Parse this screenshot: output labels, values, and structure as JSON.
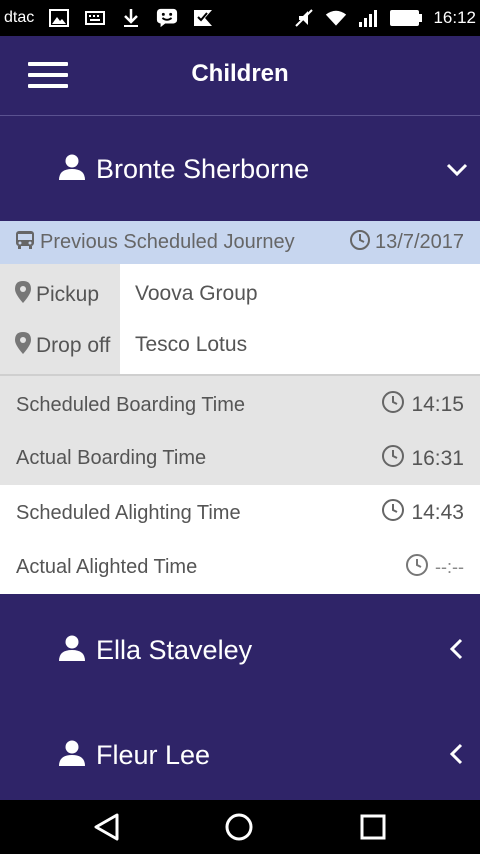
{
  "status_bar": {
    "carrier": "dtac",
    "time": "16:12",
    "left_icons": [
      "image-icon",
      "keyboard-icon",
      "download-icon",
      "emoji-icon",
      "flag-icon"
    ],
    "right_icons": [
      "mute-icon",
      "wifi-icon",
      "signal-icon",
      "battery-icon"
    ]
  },
  "app_bar": {
    "title": "Children",
    "menu_icon": "hamburger-menu-icon"
  },
  "children": [
    {
      "name": "Bronte Sherborne",
      "expanded": true
    },
    {
      "name": "Ella Staveley",
      "expanded": false
    },
    {
      "name": "Fleur Lee",
      "expanded": false
    }
  ],
  "journey": {
    "label": "Previous Scheduled Journey",
    "date": "13/7/2017",
    "pickup_label": "Pickup",
    "pickup_value": "Voova Group",
    "dropoff_label": "Drop off",
    "dropoff_value": "Tesco Lotus"
  },
  "times": [
    {
      "label": "Scheduled Boarding Time",
      "value": "14:15"
    },
    {
      "label": "Actual Boarding Time",
      "value": "16:31"
    },
    {
      "label": "Scheduled Alighting Time",
      "value": "14:43"
    },
    {
      "label": "Actual Alighted Time",
      "value": "--:--"
    }
  ],
  "colors": {
    "primary": "#2f2468",
    "journey_header": "#c7d6ef",
    "gray_band": "#e4e4e4",
    "text": "#555555"
  },
  "nav_bar": [
    "back-icon",
    "home-icon",
    "recents-icon"
  ]
}
